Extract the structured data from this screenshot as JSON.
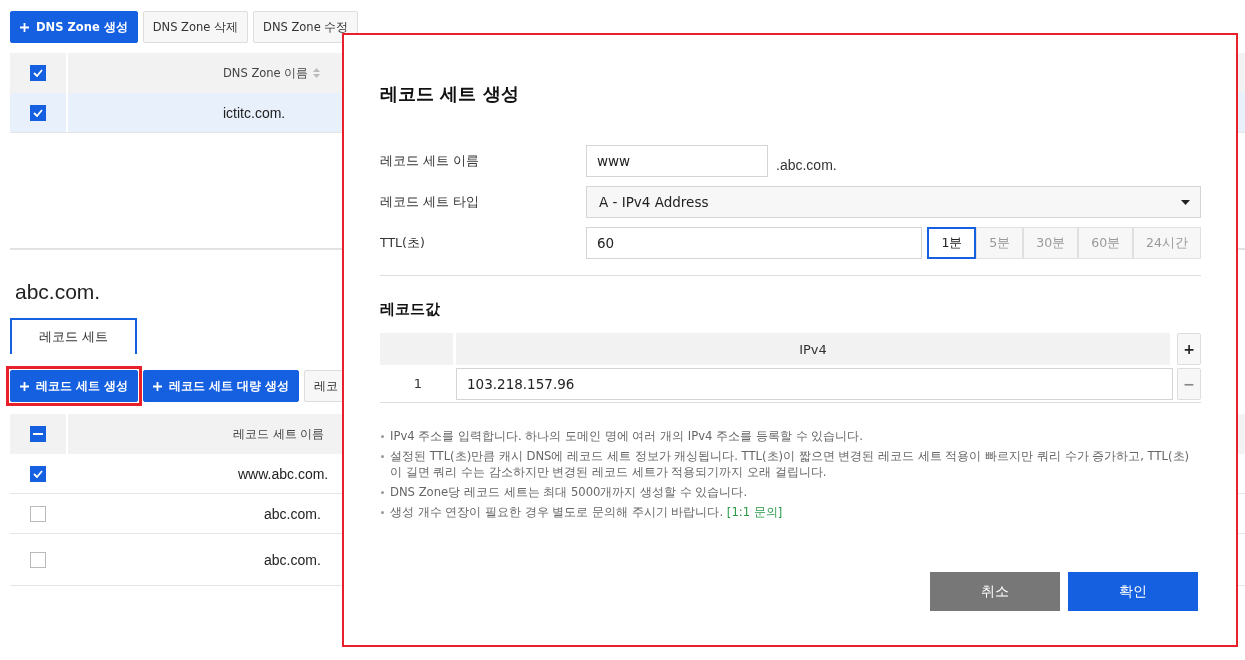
{
  "zone_toolbar": [
    {
      "kind": "primary",
      "label": "DNS Zone 생성"
    },
    {
      "kind": "secondary",
      "label": "DNS Zone 삭제"
    },
    {
      "kind": "secondary",
      "label": "DNS Zone 수정"
    }
  ],
  "zone_table": {
    "header": {
      "checked": true,
      "column": "DNS Zone 이름"
    },
    "rows": [
      {
        "checked": true,
        "selected": true,
        "name": "ictitc.com."
      }
    ]
  },
  "zone_title": "abc.com.",
  "tabs": [
    {
      "label": "레코드 세트",
      "selected": true
    }
  ],
  "record_toolbar": [
    {
      "kind": "primary",
      "label": "레코드 세트 생성",
      "highlighted": true
    },
    {
      "kind": "primary",
      "label": "레코드 세트 대량 생성",
      "highlighted": false
    },
    {
      "kind": "secondary",
      "label": "레코",
      "highlighted": false
    }
  ],
  "record_table": {
    "header": {
      "partial": true,
      "column": "레코드 세트 이름"
    },
    "rows": [
      {
        "checked": true,
        "name": "www.abc.com."
      },
      {
        "checked": false,
        "name": "abc.com."
      },
      {
        "checked": false,
        "name": "abc.com."
      }
    ]
  },
  "dialog": {
    "title": "레코드 세트 생성",
    "highlighted": true,
    "name_label": "레코드 세트 이름",
    "name_value": "www",
    "name_suffix": ".abc.com.",
    "type_label": "레코드 세트 타입",
    "type_value": "A - IPv4 Address",
    "ttl_label": "TTL(초)",
    "ttl_value": "60",
    "ttl_presets": [
      {
        "label": "1분",
        "selected": true
      },
      {
        "label": "5분",
        "selected": false
      },
      {
        "label": "30분",
        "selected": false
      },
      {
        "label": "60분",
        "selected": false
      },
      {
        "label": "24시간",
        "selected": false
      }
    ],
    "values_title": "레코드값",
    "values_column": "IPv4",
    "add_label": "+",
    "remove_label": "−",
    "values": [
      {
        "index": "1",
        "value": "103.218.157.96"
      }
    ],
    "notes": [
      {
        "text": "IPv4 주소를 입력합니다. 하나의 도메인 명에 여러 개의 IPv4 주소를 등록할 수 있습니다."
      },
      {
        "text": "설정된 TTL(초)만큼 캐시 DNS에 레코드 세트 정보가 캐싱됩니다. TTL(초)이 짧으면 변경된 레코드 세트 적용이 빠르지만 쿼리 수가 증가하고, TTL(초)이 길면 쿼리 수는 감소하지만 변경된 레코드 세트가 적용되기까지 오래 걸립니다."
      },
      {
        "text": "DNS Zone당 레코드 세트는 최대 5000개까지 생성할 수 있습니다."
      },
      {
        "text": "생성 개수 연장이 필요한 경우 별도로 문의해 주시기 바랍니다.",
        "link": "[1:1 문의]"
      }
    ],
    "buttons": [
      {
        "kind": "cancel",
        "label": "취소"
      },
      {
        "kind": "confirm",
        "label": "확인"
      }
    ]
  }
}
